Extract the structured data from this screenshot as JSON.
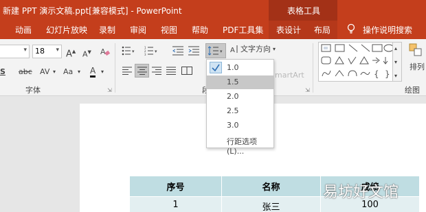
{
  "titlebar": {
    "title": "新建 PPT 演示文稿.ppt[兼容模式]  -  PowerPoint",
    "context_label": "表格工具"
  },
  "tabs": {
    "animations": "动画",
    "slideshow": "幻灯片放映",
    "record": "录制",
    "review": "审阅",
    "view": "视图",
    "help": "帮助",
    "pdf": "PDF工具集",
    "table_design": "表设计",
    "layout": "布局",
    "tell_me": "操作说明搜索"
  },
  "ribbon": {
    "font_size": "18",
    "font_group_label": "字体",
    "paragraph_group_label": "段",
    "drawing_group_label": "绘图",
    "text_direction_label": "文字方向",
    "smartart_label": "martArt",
    "arrange_label": "排列",
    "shadow_label": "S",
    "spacing_label": "AV",
    "case_label": "Aa",
    "font_color_label": "A"
  },
  "line_spacing_menu": {
    "items": [
      "1.0",
      "1.5",
      "2.0",
      "2.5",
      "3.0"
    ],
    "checked": "1.0",
    "hovered": "1.5",
    "options_label": "行距选项(L)..."
  },
  "table": {
    "headers": [
      "序号",
      "名称",
      "成绩"
    ],
    "rows": [
      [
        "1",
        "张三",
        "100"
      ]
    ]
  },
  "watermark": "易坊好文馆",
  "colors": {
    "accent": "#c43e1c",
    "context_tab": "#a33117",
    "table_header": "#bfdde2",
    "table_row": "#e3eff1"
  },
  "icons": [
    "lightbulb-icon",
    "check-icon",
    "bullets-icon",
    "numbering-icon",
    "line-spacing-icon",
    "align-left-icon",
    "align-center-icon",
    "align-right-icon",
    "justify-icon",
    "clear-formatting-icon",
    "shape-gallery",
    "arrange-icon"
  ]
}
